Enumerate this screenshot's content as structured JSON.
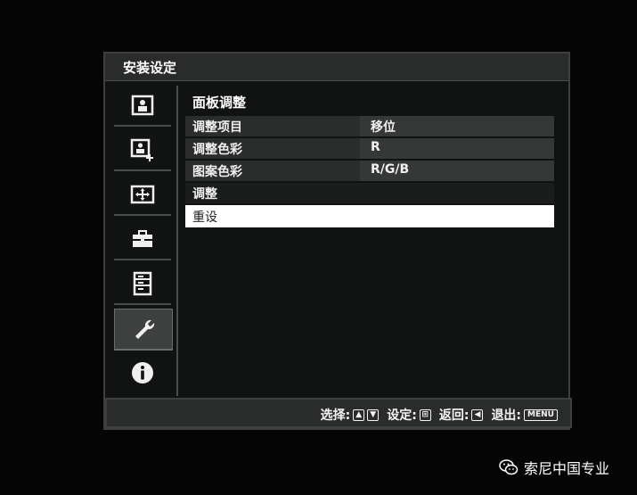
{
  "window": {
    "title": "安装设定"
  },
  "sidebar": {
    "items": [
      {
        "icon": "picture-icon"
      },
      {
        "icon": "picture-plus-icon"
      },
      {
        "icon": "screen-fit-icon"
      },
      {
        "icon": "toolbox-icon"
      },
      {
        "icon": "list-settings-icon"
      },
      {
        "icon": "wrench-icon",
        "active": true
      },
      {
        "icon": "info-icon"
      }
    ]
  },
  "main": {
    "section_title": "面板调整",
    "rows": [
      {
        "label": "调整项目",
        "value": "移位"
      },
      {
        "label": "调整色彩",
        "value": "R"
      },
      {
        "label": "图案色彩",
        "value": "R/G/B"
      }
    ],
    "adjust_label": "调整",
    "reset_label": "重设"
  },
  "statusbar": {
    "select_label": "选择:",
    "set_label": "设定:",
    "back_label": "返回:",
    "exit_label": "退出:",
    "menu_key": "MENU"
  },
  "watermark": {
    "text": "索尼中国专业"
  },
  "colors": {
    "highlight": "#ffffff",
    "panel": "#111312",
    "row": "#2b2d2c"
  }
}
